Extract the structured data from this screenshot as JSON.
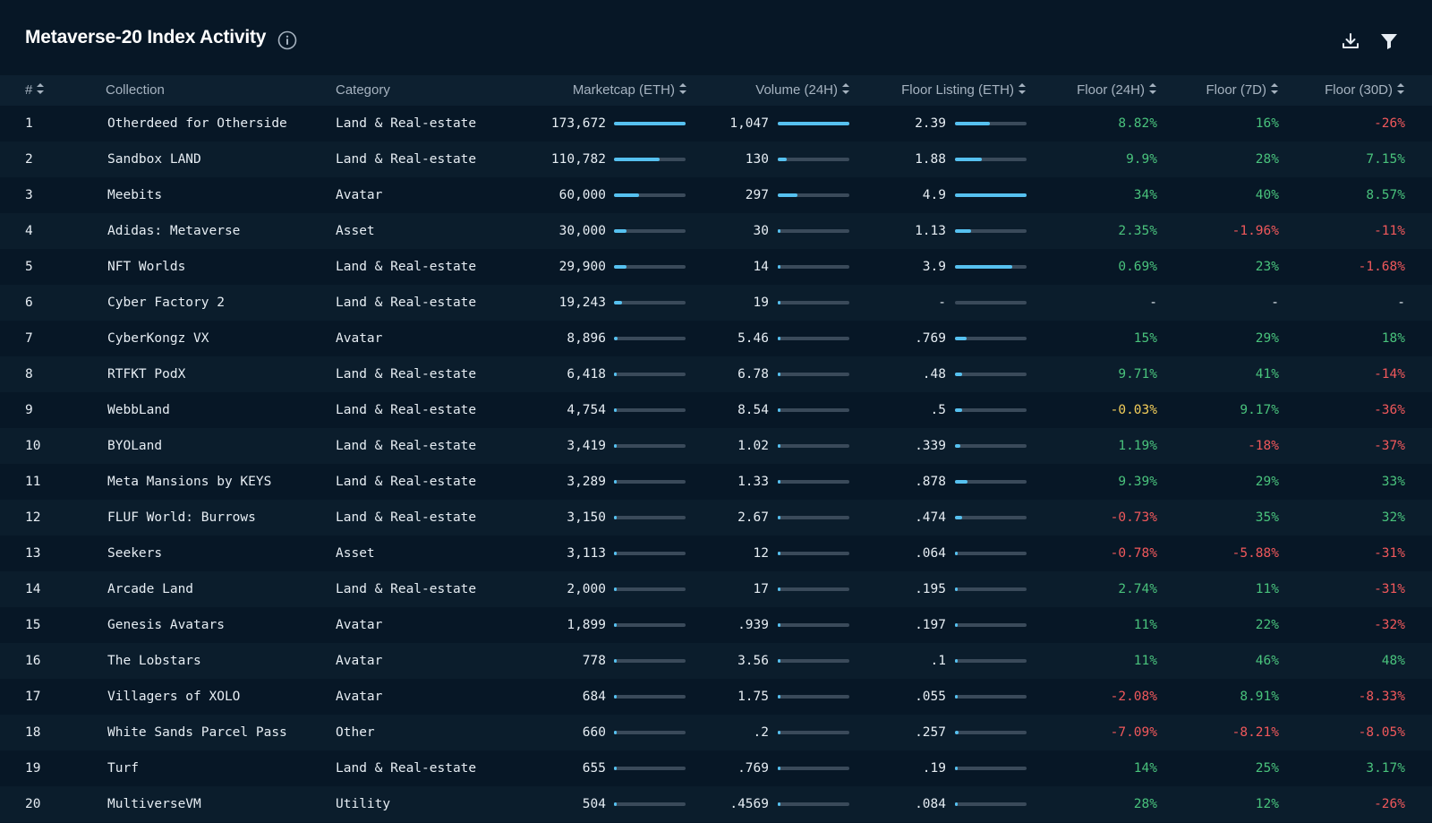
{
  "title": "Metaverse-20 Index Activity",
  "colors": {
    "background": "#071726",
    "bar": "#56c1f0",
    "positive": "#49c27c",
    "negative": "#f0585b",
    "neutral": "#f3ce5a"
  },
  "icons": {
    "info": "info-icon",
    "download": "download-icon",
    "filter": "filter-icon",
    "sort": "sort-icon"
  },
  "columns": {
    "rank": "#",
    "collection": "Collection",
    "category": "Category",
    "marketcap": "Marketcap (ETH)",
    "volume": "Volume (24H)",
    "floor_listing": "Floor Listing (ETH)",
    "floor_24h": "Floor (24H)",
    "floor_7d": "Floor (7D)",
    "floor_30d": "Floor (30D)"
  },
  "rows": [
    {
      "rank": "1",
      "collection": "Otherdeed for Otherside",
      "category": "Land & Real-estate",
      "marketcap": "173,672",
      "mc_frac": 1.0,
      "volume": "1,047",
      "vol_frac": 1.0,
      "floor": "2.39",
      "fl_frac": 0.49,
      "f24": "8.82%",
      "f24s": "pos",
      "f7": "16%",
      "f7s": "pos",
      "f30": "-26%",
      "f30s": "neg"
    },
    {
      "rank": "2",
      "collection": "Sandbox LAND",
      "category": "Land & Real-estate",
      "marketcap": "110,782",
      "mc_frac": 0.64,
      "volume": "130",
      "vol_frac": 0.12,
      "floor": "1.88",
      "fl_frac": 0.38,
      "f24": "9.9%",
      "f24s": "pos",
      "f7": "28%",
      "f7s": "pos",
      "f30": "7.15%",
      "f30s": "pos"
    },
    {
      "rank": "3",
      "collection": "Meebits",
      "category": "Avatar",
      "marketcap": "60,000",
      "mc_frac": 0.35,
      "volume": "297",
      "vol_frac": 0.28,
      "floor": "4.9",
      "fl_frac": 1.0,
      "f24": "34%",
      "f24s": "pos",
      "f7": "40%",
      "f7s": "pos",
      "f30": "8.57%",
      "f30s": "pos"
    },
    {
      "rank": "4",
      "collection": "Adidas: Metaverse",
      "category": "Asset",
      "marketcap": "30,000",
      "mc_frac": 0.17,
      "volume": "30",
      "vol_frac": 0.03,
      "floor": "1.13",
      "fl_frac": 0.23,
      "f24": "2.35%",
      "f24s": "pos",
      "f7": "-1.96%",
      "f7s": "neg",
      "f30": "-11%",
      "f30s": "neg"
    },
    {
      "rank": "5",
      "collection": "NFT Worlds",
      "category": "Land & Real-estate",
      "marketcap": "29,900",
      "mc_frac": 0.17,
      "volume": "14",
      "vol_frac": 0.013,
      "floor": "3.9",
      "fl_frac": 0.8,
      "f24": "0.69%",
      "f24s": "pos",
      "f7": "23%",
      "f7s": "pos",
      "f30": "-1.68%",
      "f30s": "neg"
    },
    {
      "rank": "6",
      "collection": "Cyber Factory 2",
      "category": "Land & Real-estate",
      "marketcap": "19,243",
      "mc_frac": 0.11,
      "volume": "19",
      "vol_frac": 0.018,
      "floor": "-",
      "fl_frac": 0,
      "f24": "-",
      "f24s": "dash",
      "f7": "-",
      "f7s": "dash",
      "f30": "-",
      "f30s": "dash"
    },
    {
      "rank": "7",
      "collection": "CyberKongz VX",
      "category": "Avatar",
      "marketcap": "8,896",
      "mc_frac": 0.05,
      "volume": "5.46",
      "vol_frac": 0.005,
      "floor": ".769",
      "fl_frac": 0.16,
      "f24": "15%",
      "f24s": "pos",
      "f7": "29%",
      "f7s": "pos",
      "f30": "18%",
      "f30s": "pos"
    },
    {
      "rank": "8",
      "collection": "RTFKT PodX",
      "category": "Land & Real-estate",
      "marketcap": "6,418",
      "mc_frac": 0.037,
      "volume": "6.78",
      "vol_frac": 0.006,
      "floor": ".48",
      "fl_frac": 0.1,
      "f24": "9.71%",
      "f24s": "pos",
      "f7": "41%",
      "f7s": "pos",
      "f30": "-14%",
      "f30s": "neg"
    },
    {
      "rank": "9",
      "collection": "WebbLand",
      "category": "Land & Real-estate",
      "marketcap": "4,754",
      "mc_frac": 0.027,
      "volume": "8.54",
      "vol_frac": 0.008,
      "floor": ".5",
      "fl_frac": 0.1,
      "f24": "-0.03%",
      "f24s": "neu",
      "f7": "9.17%",
      "f7s": "pos",
      "f30": "-36%",
      "f30s": "neg"
    },
    {
      "rank": "10",
      "collection": "BYOLand",
      "category": "Land & Real-estate",
      "marketcap": "3,419",
      "mc_frac": 0.02,
      "volume": "1.02",
      "vol_frac": 0.001,
      "floor": ".339",
      "fl_frac": 0.07,
      "f24": "1.19%",
      "f24s": "pos",
      "f7": "-18%",
      "f7s": "neg",
      "f30": "-37%",
      "f30s": "neg"
    },
    {
      "rank": "11",
      "collection": "Meta Mansions by KEYS",
      "category": "Land & Real-estate",
      "marketcap": "3,289",
      "mc_frac": 0.019,
      "volume": "1.33",
      "vol_frac": 0.001,
      "floor": ".878",
      "fl_frac": 0.18,
      "f24": "9.39%",
      "f24s": "pos",
      "f7": "29%",
      "f7s": "pos",
      "f30": "33%",
      "f30s": "pos"
    },
    {
      "rank": "12",
      "collection": "FLUF World: Burrows",
      "category": "Land & Real-estate",
      "marketcap": "3,150",
      "mc_frac": 0.018,
      "volume": "2.67",
      "vol_frac": 0.003,
      "floor": ".474",
      "fl_frac": 0.1,
      "f24": "-0.73%",
      "f24s": "neg",
      "f7": "35%",
      "f7s": "pos",
      "f30": "32%",
      "f30s": "pos"
    },
    {
      "rank": "13",
      "collection": "Seekers",
      "category": "Asset",
      "marketcap": "3,113",
      "mc_frac": 0.018,
      "volume": "12",
      "vol_frac": 0.011,
      "floor": ".064",
      "fl_frac": 0.013,
      "f24": "-0.78%",
      "f24s": "neg",
      "f7": "-5.88%",
      "f7s": "neg",
      "f30": "-31%",
      "f30s": "neg"
    },
    {
      "rank": "14",
      "collection": "Arcade Land",
      "category": "Land & Real-estate",
      "marketcap": "2,000",
      "mc_frac": 0.012,
      "volume": "17",
      "vol_frac": 0.016,
      "floor": ".195",
      "fl_frac": 0.04,
      "f24": "2.74%",
      "f24s": "pos",
      "f7": "11%",
      "f7s": "pos",
      "f30": "-31%",
      "f30s": "neg"
    },
    {
      "rank": "15",
      "collection": "Genesis Avatars",
      "category": "Avatar",
      "marketcap": "1,899",
      "mc_frac": 0.011,
      "volume": ".939",
      "vol_frac": 0.001,
      "floor": ".197",
      "fl_frac": 0.04,
      "f24": "11%",
      "f24s": "pos",
      "f7": "22%",
      "f7s": "pos",
      "f30": "-32%",
      "f30s": "neg"
    },
    {
      "rank": "16",
      "collection": "The Lobstars",
      "category": "Avatar",
      "marketcap": "778",
      "mc_frac": 0.004,
      "volume": "3.56",
      "vol_frac": 0.003,
      "floor": ".1",
      "fl_frac": 0.02,
      "f24": "11%",
      "f24s": "pos",
      "f7": "46%",
      "f7s": "pos",
      "f30": "48%",
      "f30s": "pos"
    },
    {
      "rank": "17",
      "collection": "Villagers of XOLO",
      "category": "Avatar",
      "marketcap": "684",
      "mc_frac": 0.004,
      "volume": "1.75",
      "vol_frac": 0.002,
      "floor": ".055",
      "fl_frac": 0.011,
      "f24": "-2.08%",
      "f24s": "neg",
      "f7": "8.91%",
      "f7s": "pos",
      "f30": "-8.33%",
      "f30s": "neg"
    },
    {
      "rank": "18",
      "collection": "White Sands Parcel Pass",
      "category": "Other",
      "marketcap": "660",
      "mc_frac": 0.004,
      "volume": ".2",
      "vol_frac": 0.0002,
      "floor": ".257",
      "fl_frac": 0.05,
      "f24": "-7.09%",
      "f24s": "neg",
      "f7": "-8.21%",
      "f7s": "neg",
      "f30": "-8.05%",
      "f30s": "neg"
    },
    {
      "rank": "19",
      "collection": "Turf",
      "category": "Land & Real-estate",
      "marketcap": "655",
      "mc_frac": 0.004,
      "volume": ".769",
      "vol_frac": 0.001,
      "floor": ".19",
      "fl_frac": 0.04,
      "f24": "14%",
      "f24s": "pos",
      "f7": "25%",
      "f7s": "pos",
      "f30": "3.17%",
      "f30s": "pos"
    },
    {
      "rank": "20",
      "collection": "MultiverseVM",
      "category": "Utility",
      "marketcap": "504",
      "mc_frac": 0.003,
      "volume": ".4569",
      "vol_frac": 0.0004,
      "floor": ".084",
      "fl_frac": 0.017,
      "f24": "28%",
      "f24s": "pos",
      "f7": "12%",
      "f7s": "pos",
      "f30": "-26%",
      "f30s": "neg"
    }
  ]
}
